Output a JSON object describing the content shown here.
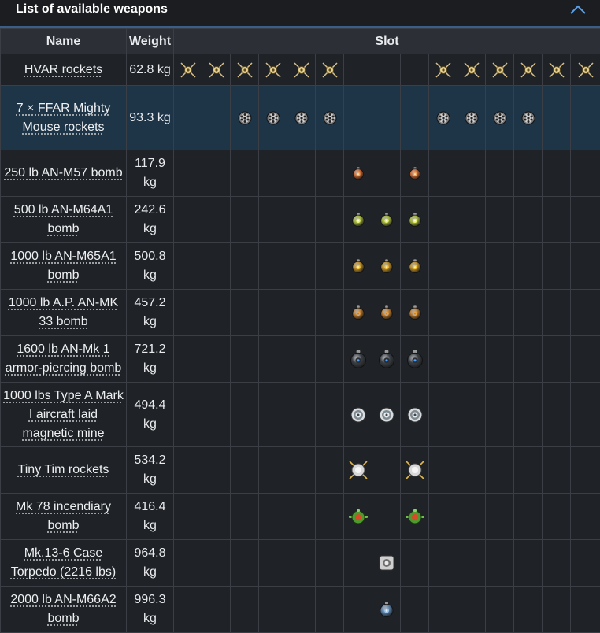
{
  "section": {
    "title": "List of available weapons",
    "toggle_icon": "chevron-up-icon"
  },
  "table": {
    "headers": {
      "name": "Name",
      "weight": "Weight",
      "slot": "Slot"
    },
    "slot_count": 15,
    "rows": [
      {
        "name": "HVAR rockets",
        "weight": "62.8 kg",
        "icon": "hvar-rocket-icon",
        "slots": [
          1,
          2,
          3,
          4,
          5,
          6,
          10,
          11,
          12,
          13,
          14,
          15
        ]
      },
      {
        "name": "7 × FFAR Mighty Mouse rockets",
        "weight": "93.3 kg",
        "icon": "ffar-rocket-pod-icon",
        "slots": [
          3,
          4,
          5,
          6,
          10,
          11,
          12,
          13
        ],
        "highlighted": true
      },
      {
        "name": "250 lb AN-M57 bomb",
        "weight": "117.9 kg",
        "icon": "small-bomb-icon",
        "slots": [
          7,
          9
        ]
      },
      {
        "name": "500 lb AN-M64A1 bomb",
        "weight": "242.6 kg",
        "icon": "medium-bomb-icon",
        "slots": [
          7,
          8,
          9
        ]
      },
      {
        "name": "1000 lb AN-M65A1 bomb",
        "weight": "500.8 kg",
        "icon": "large-bomb-icon",
        "slots": [
          7,
          8,
          9
        ]
      },
      {
        "name": "1000 lb A.P. AN-MK 33 bomb",
        "weight": "457.2 kg",
        "icon": "ap-bomb-icon",
        "slots": [
          7,
          8,
          9
        ]
      },
      {
        "name": "1600 lb AN-Mk 1 armor-piercing bomb",
        "weight": "721.2 kg",
        "icon": "heavy-ap-bomb-icon",
        "slots": [
          7,
          8,
          9
        ]
      },
      {
        "name": "1000 lbs Type A Mark I aircraft laid magnetic mine",
        "weight": "494.4 kg",
        "icon": "mine-icon",
        "slots": [
          7,
          8,
          9
        ]
      },
      {
        "name": "Tiny Tim rockets",
        "weight": "534.2 kg",
        "icon": "tiny-tim-rocket-icon",
        "slots": [
          7,
          9
        ]
      },
      {
        "name": "Mk 78 incendiary bomb",
        "weight": "416.4 kg",
        "icon": "incendiary-bomb-icon",
        "slots": [
          7,
          9
        ]
      },
      {
        "name": "Mk.13-6 Case Torpedo (2216 lbs)",
        "weight": "964.8 kg",
        "icon": "torpedo-icon",
        "slots": [
          8
        ]
      },
      {
        "name": "2000 lb AN-M66A2 bomb",
        "weight": "996.3 kg",
        "icon": "heavy-bomb-icon",
        "slots": [
          8
        ]
      }
    ]
  },
  "colors": {
    "header_bg": "#2c3036",
    "row_bg": "#1f2226",
    "highlight_bg": "#1e3447",
    "accent_bar": "#3a5e86"
  }
}
